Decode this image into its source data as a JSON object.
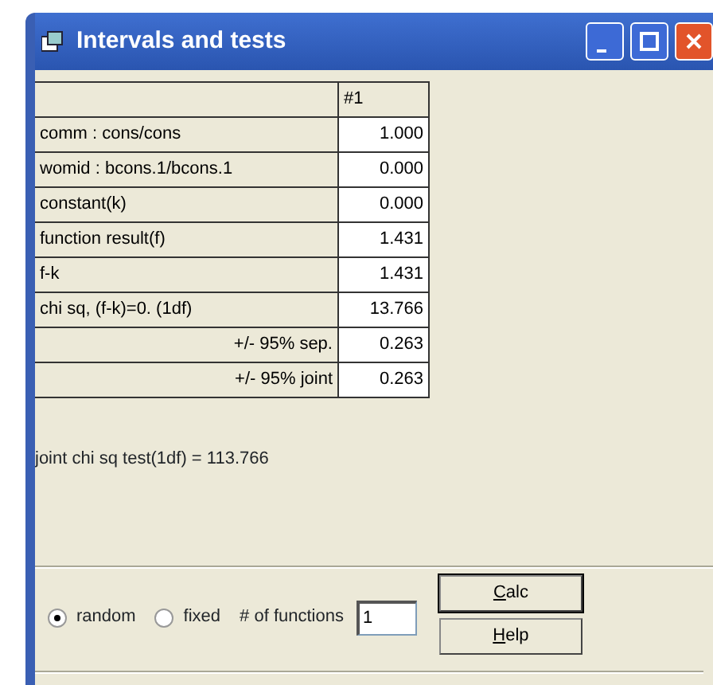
{
  "window": {
    "title": "Intervals and tests"
  },
  "table": {
    "columns": [
      "",
      "#1"
    ],
    "rows": [
      {
        "label": "comm : cons/cons",
        "value": "1.000",
        "kind": "term"
      },
      {
        "label": "womid : bcons.1/bcons.1",
        "value": "0.000",
        "kind": "term"
      },
      {
        "label": "constant(k)",
        "value": "0.000",
        "kind": "term"
      },
      {
        "label": "function result(f)",
        "value": "1.431",
        "kind": "term"
      },
      {
        "label": "f-k",
        "value": "1.431",
        "kind": "term"
      },
      {
        "label": "chi sq, (f-k)=0. (1df)",
        "value": "13.766",
        "kind": "term"
      },
      {
        "label": "+/- 95% sep.",
        "value": "0.263",
        "kind": "interval"
      },
      {
        "label": "+/- 95% joint",
        "value": "0.263",
        "kind": "interval"
      }
    ]
  },
  "result": "joint chi sq test(1df) = 113.766",
  "options": [
    {
      "label": "random",
      "selected": true
    },
    {
      "label": "fixed",
      "selected": false
    }
  ],
  "functions_field": {
    "label": "# of functions",
    "value": "1"
  },
  "buttons": [
    {
      "label": "Calc",
      "default": true,
      "mnemonic": true
    },
    {
      "label": "Help",
      "default": false,
      "mnemonic": true
    }
  ]
}
